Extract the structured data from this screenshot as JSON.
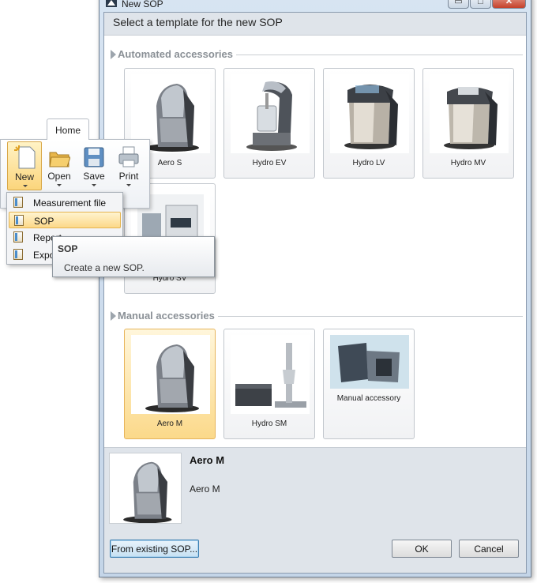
{
  "window": {
    "title": "New SOP",
    "controls": {
      "minimize": "▭",
      "maximize": "□",
      "close": "✕"
    }
  },
  "header": {
    "text": "Select a template for the new SOP"
  },
  "groups": [
    {
      "title": "Automated accessories",
      "items": [
        "Aero S",
        "Hydro EV",
        "Hydro LV",
        "Hydro MV",
        "Hydro SV"
      ]
    },
    {
      "title": "Manual accessories",
      "items": [
        "Aero M",
        "Hydro SM",
        "Manual accessory"
      ]
    }
  ],
  "selected_template": "Aero M",
  "preview": {
    "name": "Aero M",
    "description": "Aero M"
  },
  "buttons": {
    "from_existing": "From existing SOP...",
    "ok": "OK",
    "cancel": "Cancel"
  },
  "ribbon": {
    "tab": "Home",
    "buttons": [
      {
        "label": "New",
        "icon": "new-document-icon",
        "active": true
      },
      {
        "label": "Open",
        "icon": "open-folder-icon"
      },
      {
        "label": "Save",
        "icon": "save-disk-icon"
      },
      {
        "label": "Print",
        "icon": "printer-icon"
      }
    ]
  },
  "new_menu": {
    "items": [
      "Measurement file",
      "SOP",
      "Report",
      "Export"
    ],
    "highlighted": "SOP"
  },
  "tooltip": {
    "title": "SOP",
    "body": "Create a new SOP."
  },
  "colors": {
    "selection": "#fbd98a",
    "header_bg": "#dfe4ea",
    "window_frame": "#c4d5e8"
  }
}
